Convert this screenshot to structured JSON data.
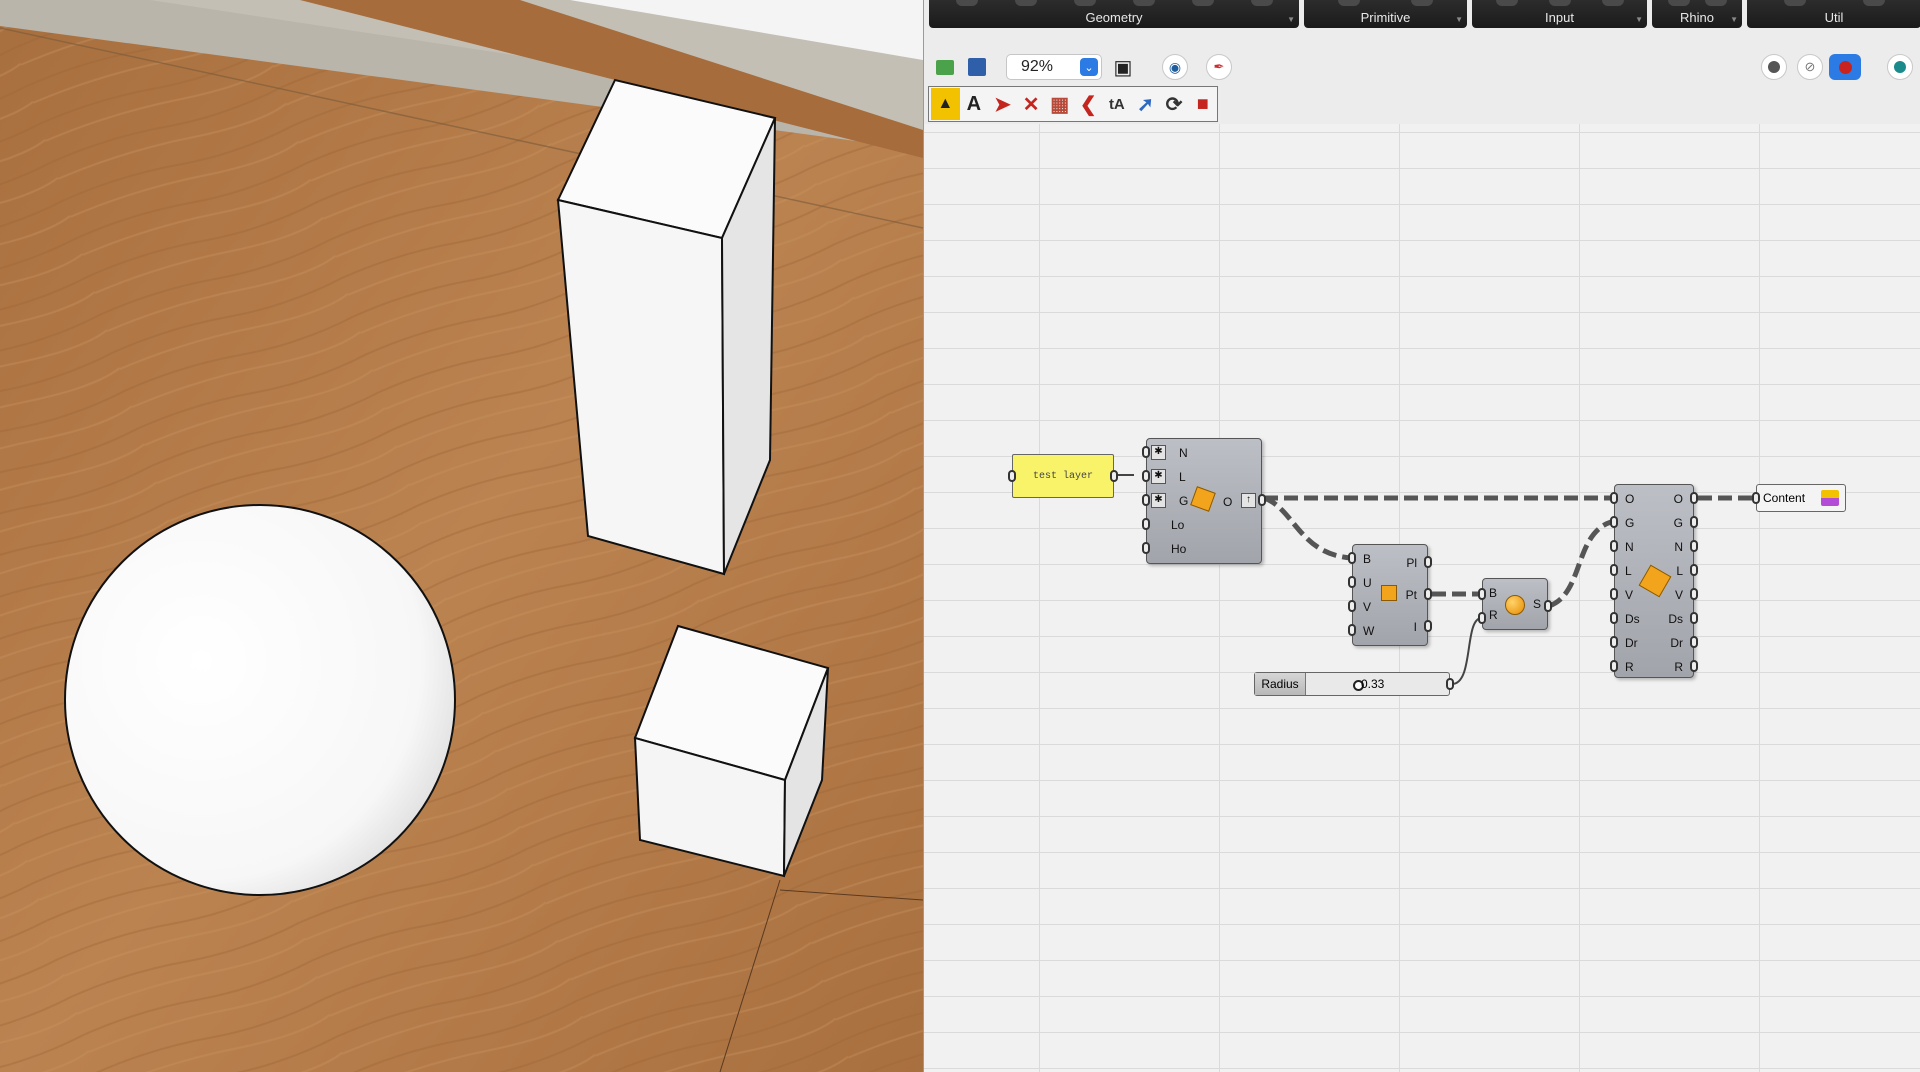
{
  "ribbon": {
    "tabs": [
      {
        "label": "Geometry"
      },
      {
        "label": "Primitive"
      },
      {
        "label": "Input"
      },
      {
        "label": "Rhino"
      },
      {
        "label": "Util"
      }
    ]
  },
  "toolbar": {
    "zoom": "92%"
  },
  "panel": {
    "text": "test layer"
  },
  "query_component": {
    "inputs": [
      "N",
      "L",
      "G",
      "Lo",
      "Ho"
    ],
    "output": "O"
  },
  "pt_component": {
    "inputs": [
      "B",
      "U",
      "V",
      "W"
    ],
    "outputs": [
      "Pl",
      "Pt",
      "I"
    ]
  },
  "sphere_component": {
    "inputs": [
      "B",
      "R"
    ],
    "output": "S"
  },
  "bake_component": {
    "inputs": [
      "O",
      "G",
      "N",
      "L",
      "V",
      "Ds",
      "Dr",
      "R"
    ],
    "outputs": [
      "O",
      "G",
      "N",
      "L",
      "V",
      "Ds",
      "Dr",
      "R"
    ]
  },
  "slider": {
    "name": "Radius",
    "value": "0.33"
  },
  "content_param": {
    "label": "Content"
  },
  "colors": {
    "wood": "#b47a45",
    "canvas": "#f1f1f1",
    "panel_yellow": "#f9f36a",
    "accent_blue": "#2c7be5"
  }
}
